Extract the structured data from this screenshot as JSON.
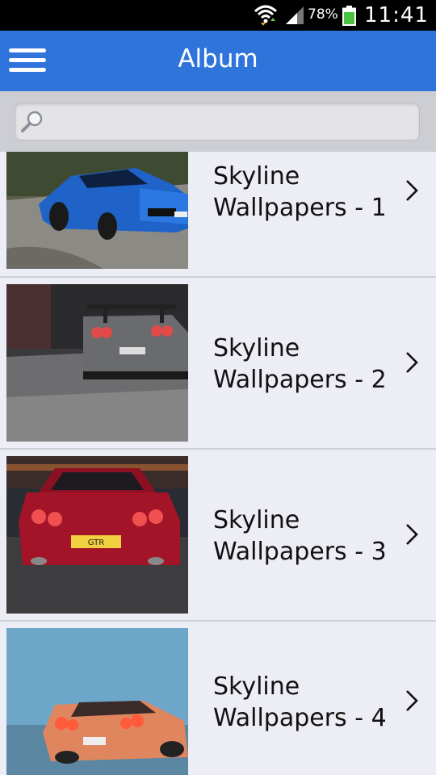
{
  "status_bar": {
    "battery_percent": "78%",
    "time": "11:41",
    "icons": [
      "wifi-icon",
      "signal-icon",
      "battery-icon"
    ]
  },
  "app_bar": {
    "title": "Album",
    "menu_icon": "hamburger-menu-icon"
  },
  "search": {
    "placeholder": "",
    "value": "",
    "icon": "magnifier-icon"
  },
  "album_items": [
    {
      "title": "Skyline\nWallpapers - 1",
      "thumbnail": "blue Nissan Skyline GT-R R34 on road"
    },
    {
      "title": "Skyline\nWallpapers - 2",
      "thumbnail": "grey Nissan Skyline rear view"
    },
    {
      "title": "Skyline\nWallpapers - 3",
      "thumbnail": "red Nissan GT-R rear view with GTR plate"
    },
    {
      "title": "Skyline\nWallpapers - 4",
      "thumbnail": "orange Nissan GT-R in fog"
    }
  ],
  "colors": {
    "app_bar": "#2e74db",
    "list_background": "#ededf5",
    "search_background": "#cdced3"
  }
}
